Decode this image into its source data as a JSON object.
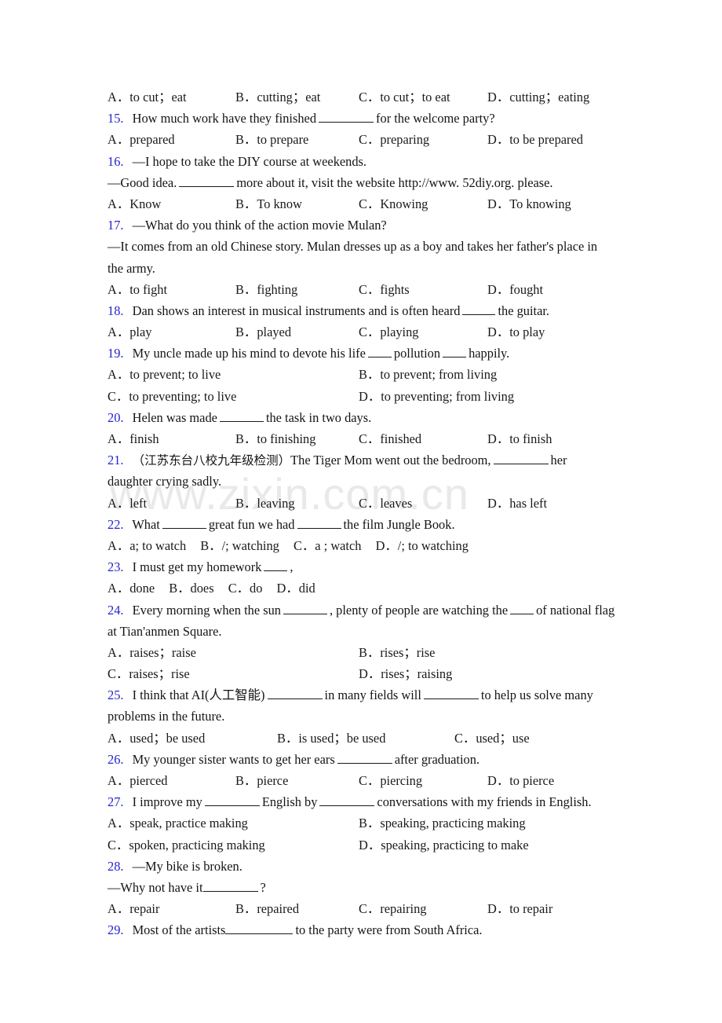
{
  "document": {
    "kind": "english-grammar-worksheet",
    "watermark": "www.zixin.com.cn",
    "number_color": "#2424cf",
    "text_color": "#141414"
  },
  "items": [
    {
      "id": "q14-options",
      "type": "options",
      "columns": 4,
      "options": [
        "A．to cut；eat",
        "B．cutting；eat",
        "C．to cut；to eat",
        "D．cutting；eating"
      ]
    },
    {
      "id": "q15",
      "number": "15.",
      "stem_before": "How much work have they finished",
      "stem_after": "for the welcome party?"
    },
    {
      "id": "q15-options",
      "type": "options",
      "columns": 4,
      "options": [
        "A．prepared",
        "B．to prepare",
        "C．preparing",
        "D．to be prepared"
      ]
    },
    {
      "id": "q16",
      "number": "16.",
      "stem_before": "—I hope to take the DIY course at weekends.",
      "stem_after": ""
    },
    {
      "id": "q16-line2",
      "type": "continuation",
      "before": "—Good idea.",
      "after": "more about it, visit the website http://www. 52diy.org. please."
    },
    {
      "id": "q16-options",
      "type": "options",
      "columns": 4,
      "options": [
        "A．Know",
        "B．To know",
        "C．Knowing",
        "D．To knowing"
      ]
    },
    {
      "id": "q17",
      "number": "17.",
      "stem_before": "—What do you think of the action movie Mulan?",
      "stem_after": ""
    },
    {
      "id": "q17-line2",
      "type": "paragraph",
      "text": "—It comes from an old Chinese story. Mulan dresses up as a boy and takes her father's place in the army."
    },
    {
      "id": "q17-options",
      "type": "options",
      "columns": 4,
      "options": [
        "A．to fight",
        "B．fighting",
        "C．fights",
        "D．fought"
      ]
    },
    {
      "id": "q18",
      "number": "18.",
      "stem_before": "Dan shows an interest in musical instruments and is often heard",
      "stem_after": "the guitar."
    },
    {
      "id": "q18-options",
      "type": "options",
      "columns": 4,
      "options": [
        "A．play",
        "B．played",
        "C．playing",
        "D．to play"
      ]
    },
    {
      "id": "q19",
      "number": "19.",
      "stem_before": "My uncle made up his mind to devote his life",
      "stem_mid": "pollution",
      "stem_after": "happily."
    },
    {
      "id": "q19-options",
      "type": "options",
      "columns": 2,
      "options": [
        "A．to prevent; to live",
        "B．to prevent; from living",
        "C．to preventing; to live",
        "D．to preventing; from living"
      ]
    },
    {
      "id": "q20",
      "number": "20.",
      "stem_before": "Helen was made",
      "stem_after": "the task in two days."
    },
    {
      "id": "q20-options",
      "type": "options",
      "columns": 4,
      "options": [
        "A．finish",
        "B．to finishing",
        "C．finished",
        "D．to finish"
      ]
    },
    {
      "id": "q21",
      "number": "21.",
      "source_tag": "（江苏东台八校九年级检测）",
      "stem_before": "The Tiger Mom went out the bedroom,",
      "stem_after": "her",
      "stem_line2": "daughter crying sadly."
    },
    {
      "id": "q21-options",
      "type": "options",
      "columns": 4,
      "options": [
        "A．left",
        "B．leaving",
        "C．leaves",
        "D．has left"
      ]
    },
    {
      "id": "q22",
      "number": "22.",
      "stem_before": "What",
      "stem_mid": "great fun we had",
      "stem_after": "the film Jungle Book."
    },
    {
      "id": "q22-options",
      "type": "options",
      "columns": "inline",
      "options": [
        "A．a; to watch",
        "B．/; watching",
        "C．a ; watch",
        "D．/; to watching"
      ]
    },
    {
      "id": "q23",
      "number": "23.",
      "stem_before": "I must get my homework",
      "stem_after": ","
    },
    {
      "id": "q23-options",
      "type": "options",
      "columns": "inline",
      "options": [
        "A．done",
        "B．does",
        "C．do",
        "D．did"
      ]
    },
    {
      "id": "q24",
      "number": "24.",
      "stem_before": "Every morning when the sun",
      "stem_mid": ", plenty of people are watching the",
      "stem_after": "of national flag",
      "stem_line2": "at Tian'anmen Square."
    },
    {
      "id": "q24-options",
      "type": "options",
      "columns": 2,
      "options": [
        "A．raises；raise",
        "B．rises；rise",
        "C．raises；rise",
        "D．rises；raising"
      ]
    },
    {
      "id": "q25",
      "number": "25.",
      "stem_before": "I think that AI(人工智能)",
      "stem_mid": "in many fields will",
      "stem_after": "to help us solve many",
      "stem_line2": "problems in the future."
    },
    {
      "id": "q25-options",
      "type": "options",
      "columns": 3,
      "options": [
        "A．used；be used",
        "B．is used；be used",
        "C．used；use"
      ]
    },
    {
      "id": "q26",
      "number": "26.",
      "stem_before": "My younger sister wants to get her ears",
      "stem_after": "after graduation."
    },
    {
      "id": "q26-options",
      "type": "options",
      "columns": 4,
      "options": [
        "A．pierced",
        "B．pierce",
        "C．piercing",
        "D．to pierce"
      ]
    },
    {
      "id": "q27",
      "number": "27.",
      "stem_before": "I improve my",
      "stem_mid": "English by",
      "stem_after": "conversations with my friends in English."
    },
    {
      "id": "q27-options",
      "type": "options",
      "columns": 2,
      "options": [
        "A．speak, practice making",
        "B．speaking, practicing making",
        "C．spoken, practicing making",
        "D．speaking, practicing to make"
      ]
    },
    {
      "id": "q28",
      "number": "28.",
      "stem_before": "—My bike is broken.",
      "stem_after": ""
    },
    {
      "id": "q28-line2",
      "type": "continuation",
      "before": "—Why not have it",
      "after": "?"
    },
    {
      "id": "q28-options",
      "type": "options",
      "columns": 4,
      "options": [
        "A．repair",
        "B．repaired",
        "C．repairing",
        "D．to repair"
      ]
    },
    {
      "id": "q29",
      "number": "29.",
      "stem_before": "Most of the artists",
      "stem_after": "to the party were from South Africa."
    }
  ]
}
